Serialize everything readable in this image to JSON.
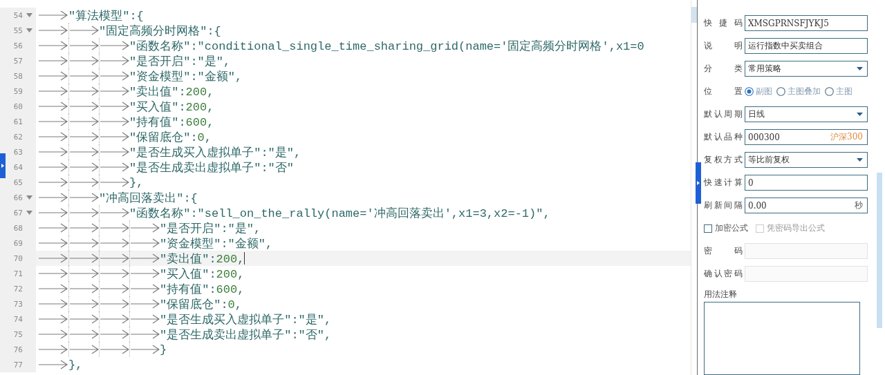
{
  "editor": {
    "lines": [
      {
        "number": "54",
        "text": "\t\"算法模型\":{",
        "foldable": true,
        "current": false
      },
      {
        "number": "55",
        "text": "\t\t\"固定高频分时网格\":{",
        "foldable": true,
        "current": false
      },
      {
        "number": "56",
        "text": "\t\t\t\"函数名称\":\"conditional_single_time_sharing_grid(name='固定高频分时网格',x1=0",
        "foldable": false,
        "current": false
      },
      {
        "number": "57",
        "text": "\t\t\t\"是否开启\":\"是\",",
        "foldable": false,
        "current": false
      },
      {
        "number": "58",
        "text": "\t\t\t\"资金模型\":\"金额\",",
        "foldable": false,
        "current": false
      },
      {
        "number": "59",
        "text": "\t\t\t\"卖出值\":200,",
        "foldable": false,
        "current": false
      },
      {
        "number": "60",
        "text": "\t\t\t\"买入值\":200,",
        "foldable": false,
        "current": false
      },
      {
        "number": "61",
        "text": "\t\t\t\"持有值\":600,",
        "foldable": false,
        "current": false
      },
      {
        "number": "62",
        "text": "\t\t\t\"保留底仓\":0,",
        "foldable": false,
        "current": false
      },
      {
        "number": "63",
        "text": "\t\t\t\"是否生成买入虚拟单子\":\"是\",",
        "foldable": false,
        "current": false
      },
      {
        "number": "64",
        "text": "\t\t\t\"是否生成卖出虚拟单子\":\"否\"",
        "foldable": false,
        "current": false
      },
      {
        "number": "65",
        "text": "\t\t\t},",
        "foldable": false,
        "current": false
      },
      {
        "number": "66",
        "text": "\t\t\"冲高回落卖出\":{",
        "foldable": true,
        "current": false
      },
      {
        "number": "67",
        "text": "\t\t\t\"函数名称\":\"sell_on_the_rally(name='冲高回落卖出',x1=3,x2=-1)\",",
        "foldable": true,
        "current": false
      },
      {
        "number": "68",
        "text": "\t\t\t\t\"是否开启\":\"是\",",
        "foldable": false,
        "current": false
      },
      {
        "number": "69",
        "text": "\t\t\t\t\"资金模型\":\"金额\",",
        "foldable": false,
        "current": false
      },
      {
        "number": "70",
        "text": "\t\t\t\t\"卖出值\":200,",
        "foldable": false,
        "current": true
      },
      {
        "number": "71",
        "text": "\t\t\t\t\"买入值\":200,",
        "foldable": false,
        "current": false
      },
      {
        "number": "72",
        "text": "\t\t\t\t\"持有值\":600,",
        "foldable": false,
        "current": false
      },
      {
        "number": "73",
        "text": "\t\t\t\t\"保留底仓\":0,",
        "foldable": false,
        "current": false
      },
      {
        "number": "74",
        "text": "\t\t\t\t\"是否生成买入虚拟单子\":\"是\",",
        "foldable": false,
        "current": false
      },
      {
        "number": "75",
        "text": "\t\t\t\t\"是否生成卖出虚拟单子\":\"否\",",
        "foldable": false,
        "current": false
      },
      {
        "number": "76",
        "text": "\t\t\t\t}",
        "foldable": false,
        "current": false
      },
      {
        "number": "77",
        "text": "\t},",
        "foldable": false,
        "current": false
      }
    ]
  },
  "panel": {
    "fields": [
      {
        "kind": "text",
        "label": "快捷码",
        "value": "XMSGPRNSFJYKJ5",
        "disabled": false
      },
      {
        "kind": "text",
        "label": "说明",
        "value": "运行指数中买卖组合",
        "disabled": false
      },
      {
        "kind": "select",
        "label": "分类",
        "value": "常用策略",
        "disabled": false
      },
      {
        "kind": "radio",
        "label": "位置",
        "options": [
          {
            "label": "副图",
            "selected": true
          },
          {
            "label": "主图叠加",
            "selected": false
          },
          {
            "label": "主图",
            "selected": false
          }
        ]
      },
      {
        "kind": "select",
        "label": "默认周期",
        "value": "日线",
        "disabled": false
      },
      {
        "kind": "text",
        "label": "默认品种",
        "value": "000300",
        "suffix": {
          "text": "沪深300",
          "color": "#e08a3c"
        },
        "disabled": false
      },
      {
        "kind": "select",
        "label": "复权方式",
        "value": "等比前复权",
        "disabled": false
      },
      {
        "kind": "text",
        "label": "快速计算",
        "value": "0",
        "disabled": false
      },
      {
        "kind": "text",
        "label": "刷新间隔",
        "value": "0.00",
        "suffix": {
          "text": "秒",
          "color": "#555555"
        },
        "disabled": false
      },
      {
        "kind": "checks",
        "options": [
          {
            "label": "加密公式",
            "checked": false,
            "disabled": false
          },
          {
            "label": "凭密码导出公式",
            "checked": false,
            "disabled": true
          }
        ]
      },
      {
        "kind": "text",
        "label": "密码",
        "disabled": true
      },
      {
        "kind": "text",
        "label": "确认密码",
        "disabled": true
      },
      {
        "kind": "textarea",
        "label": "用法注释"
      }
    ]
  }
}
